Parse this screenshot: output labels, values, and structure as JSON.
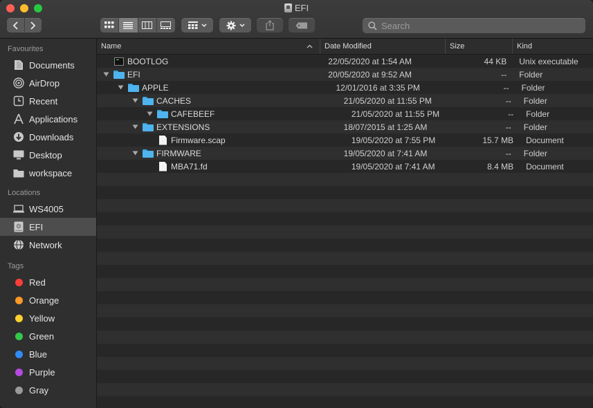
{
  "window": {
    "title": "EFI"
  },
  "toolbar": {
    "search_placeholder": "Search"
  },
  "sidebar": {
    "favourites_heading": "Favourites",
    "favourites": [
      {
        "label": "Documents",
        "icon": "document-icon"
      },
      {
        "label": "AirDrop",
        "icon": "airdrop-icon"
      },
      {
        "label": "Recent",
        "icon": "clock-icon"
      },
      {
        "label": "Applications",
        "icon": "applications-icon"
      },
      {
        "label": "Downloads",
        "icon": "download-icon"
      },
      {
        "label": "Desktop",
        "icon": "desktop-icon"
      },
      {
        "label": "workspace",
        "icon": "folder-icon"
      }
    ],
    "locations_heading": "Locations",
    "locations": [
      {
        "label": "WS4005",
        "icon": "laptop-icon"
      },
      {
        "label": "EFI",
        "icon": "disk-icon",
        "selected": true
      },
      {
        "label": "Network",
        "icon": "globe-icon"
      }
    ],
    "tags_heading": "Tags",
    "tags": [
      {
        "label": "Red",
        "color": "#fc3d39"
      },
      {
        "label": "Orange",
        "color": "#fd9a28"
      },
      {
        "label": "Yellow",
        "color": "#fecf30"
      },
      {
        "label": "Green",
        "color": "#34c84a"
      },
      {
        "label": "Blue",
        "color": "#2f8bf5"
      },
      {
        "label": "Purple",
        "color": "#b54ae0"
      },
      {
        "label": "Gray",
        "color": "#9a9a9a"
      }
    ]
  },
  "columns": {
    "name": "Name",
    "date": "Date Modified",
    "size": "Size",
    "kind": "Kind"
  },
  "files": [
    {
      "name": "BOOTLOG",
      "date": "22/05/2020 at 1:54 AM",
      "size": "44 KB",
      "kind": "Unix executable",
      "type": "exec",
      "depth": 0,
      "expandable": false
    },
    {
      "name": "EFI",
      "date": "20/05/2020 at 9:52 AM",
      "size": "--",
      "kind": "Folder",
      "type": "folder",
      "depth": 0,
      "expandable": true
    },
    {
      "name": "APPLE",
      "date": "12/01/2016 at 3:35 PM",
      "size": "--",
      "kind": "Folder",
      "type": "folder",
      "depth": 1,
      "expandable": true
    },
    {
      "name": "CACHES",
      "date": "21/05/2020 at 11:55 PM",
      "size": "--",
      "kind": "Folder",
      "type": "folder",
      "depth": 2,
      "expandable": true
    },
    {
      "name": "CAFEBEEF",
      "date": "21/05/2020 at 11:55 PM",
      "size": "--",
      "kind": "Folder",
      "type": "folder",
      "depth": 3,
      "expandable": true
    },
    {
      "name": "EXTENSIONS",
      "date": "18/07/2015 at 1:25 AM",
      "size": "--",
      "kind": "Folder",
      "type": "folder",
      "depth": 2,
      "expandable": true
    },
    {
      "name": "Firmware.scap",
      "date": "19/05/2020 at 7:55 PM",
      "size": "15.7 MB",
      "kind": "Document",
      "type": "file",
      "depth": 3,
      "expandable": false
    },
    {
      "name": "FIRMWARE",
      "date": "19/05/2020 at 7:41 AM",
      "size": "--",
      "kind": "Folder",
      "type": "folder",
      "depth": 2,
      "expandable": true
    },
    {
      "name": "MBA71.fd",
      "date": "19/05/2020 at 7:41 AM",
      "size": "8.4 MB",
      "kind": "Document",
      "type": "file",
      "depth": 3,
      "expandable": false
    }
  ]
}
